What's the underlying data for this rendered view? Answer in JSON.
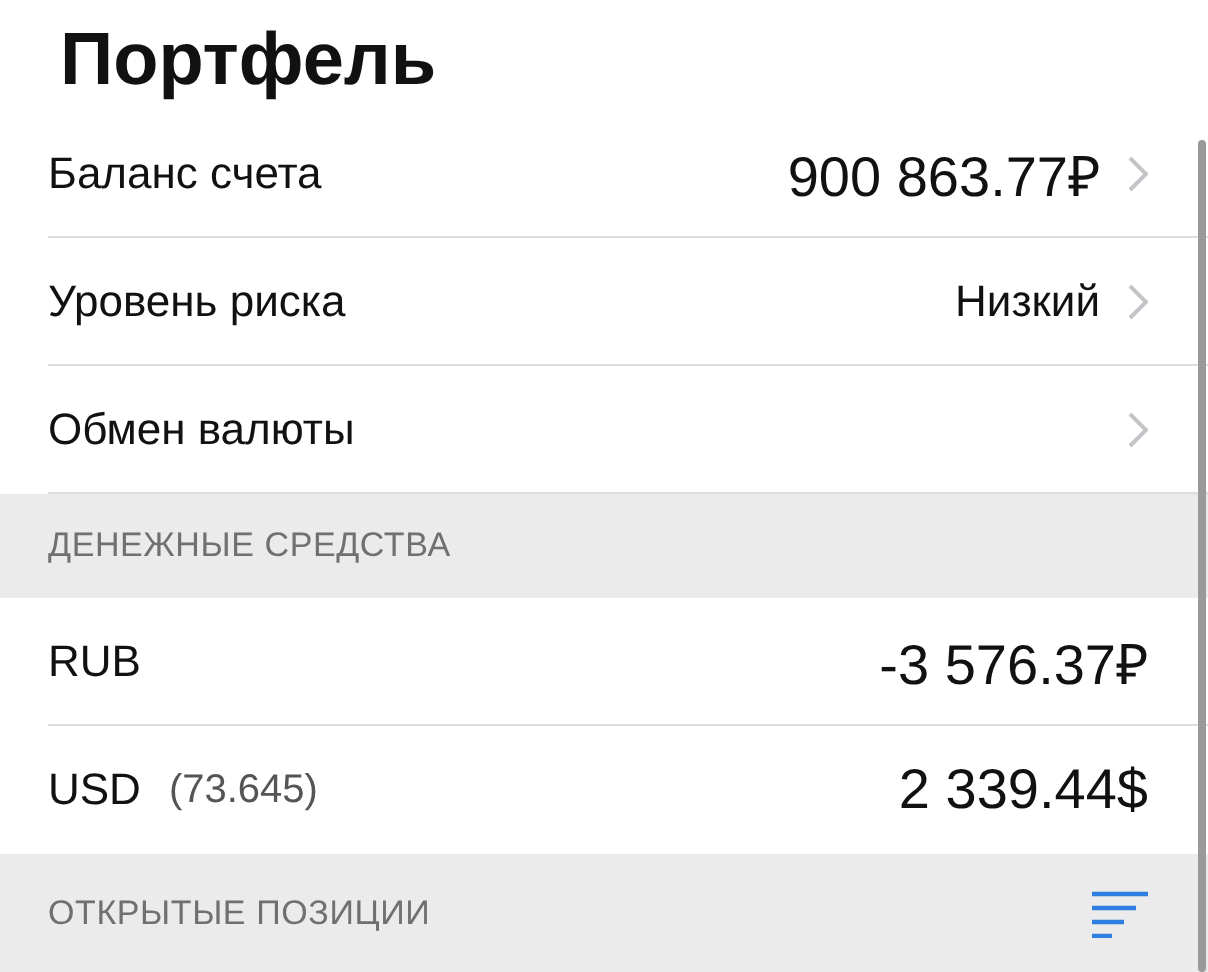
{
  "title": "Портфель",
  "menu_rows": [
    {
      "label": "Баланс счета",
      "value": "900 863.77₽",
      "kind": "amount"
    },
    {
      "label": "Уровень риска",
      "value": "Низкий",
      "kind": "text"
    },
    {
      "label": "Обмен валюты"
    }
  ],
  "cash_section": {
    "header": "ДЕНЕЖНЫЕ СРЕДСТВА",
    "rows": [
      {
        "currency": "RUB",
        "amount": "-3 576.37₽"
      },
      {
        "currency": "USD",
        "rate": "(73.645)",
        "amount": "2 339.44$"
      }
    ]
  },
  "positions_section": {
    "header": "ОТКРЫТЫЕ ПОЗИЦИИ"
  }
}
